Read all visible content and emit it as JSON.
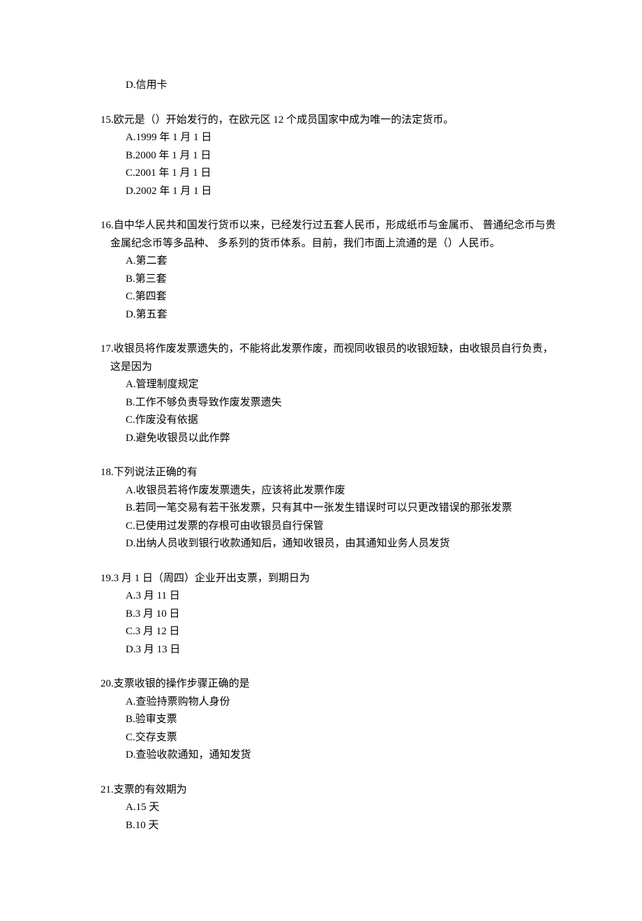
{
  "orphan": {
    "optD": "D.信用卡"
  },
  "q15": {
    "text": "15.欧元是（）开始发行的，在欧元区 12 个成员国家中成为唯一的法定货币。",
    "optA": "A.1999 年 1 月 1 日",
    "optB": "B.2000 年 1 月 1 日",
    "optC": "C.2001 年 1 月 1 日",
    "optD": "D.2002 年 1 月 1 日"
  },
  "q16": {
    "text": "16.自中华人民共和国发行货币以来，已经发行过五套人民币，形成纸币与金属币、 普通纪念币与贵金属纪念币等多品种、 多系列的货币体系。目前，我们市面上流通的是（）人民币。",
    "optA": "A.第二套",
    "optB": "B.第三套",
    "optC": "C.第四套",
    "optD": "D.第五套"
  },
  "q17": {
    "text": "17.收银员将作废发票遗失的，不能将此发票作废，而视同收银员的收银短缺，由收银员自行负责，这是因为",
    "optA": "A.管理制度规定",
    "optB": "B.工作不够负责导致作废发票遗失",
    "optC": "C.作废没有依据",
    "optD": "D.避免收银员以此作弊"
  },
  "q18": {
    "text": "18.下列说法正确的有",
    "optA": "A.收银员若将作废发票遗失，应该将此发票作废",
    "optB": "B.若同一笔交易有若干张发票，只有其中一张发生错误时可以只更改错误的那张发票",
    "optC": "C.已使用过发票的存根可由收银员自行保管",
    "optD": "D.出纳人员收到银行收款通知后，通知收银员，由其通知业务人员发货"
  },
  "q19": {
    "text": "19.3 月 1 日（周四）企业开出支票，到期日为",
    "optA": "A.3 月 11 日",
    "optB": "B.3 月 10 日",
    "optC": "C.3 月 12 日",
    "optD": "D.3 月 13 日"
  },
  "q20": {
    "text": "20.支票收银的操作步骤正确的是",
    "optA": "A.查验持票购物人身份",
    "optB": "B.验审支票",
    "optC": "C.交存支票",
    "optD": "D.查验收款通知，通知发货"
  },
  "q21": {
    "text": "21.支票的有效期为",
    "optA": "A.15 天",
    "optB": "B.10 天"
  }
}
